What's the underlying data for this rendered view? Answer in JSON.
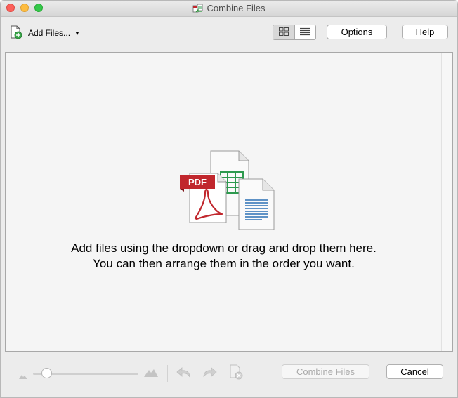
{
  "window": {
    "title": "Combine Files"
  },
  "toolbar": {
    "add_files_label": "Add Files...",
    "view_mode": "thumbnails",
    "options_label": "Options",
    "help_label": "Help"
  },
  "dropzone": {
    "message_line1": "Add files using the dropdown or drag and drop them here.",
    "message_line2": "You can then arrange them in the order you want.",
    "pdf_badge": "PDF"
  },
  "footer": {
    "combine_label": "Combine Files",
    "cancel_label": "Cancel",
    "zoom_level": 0.08
  },
  "colors": {
    "pdf_red": "#c1272d",
    "spreadsheet_green": "#2e9a4f",
    "doc_blue": "#2a6fb5"
  }
}
